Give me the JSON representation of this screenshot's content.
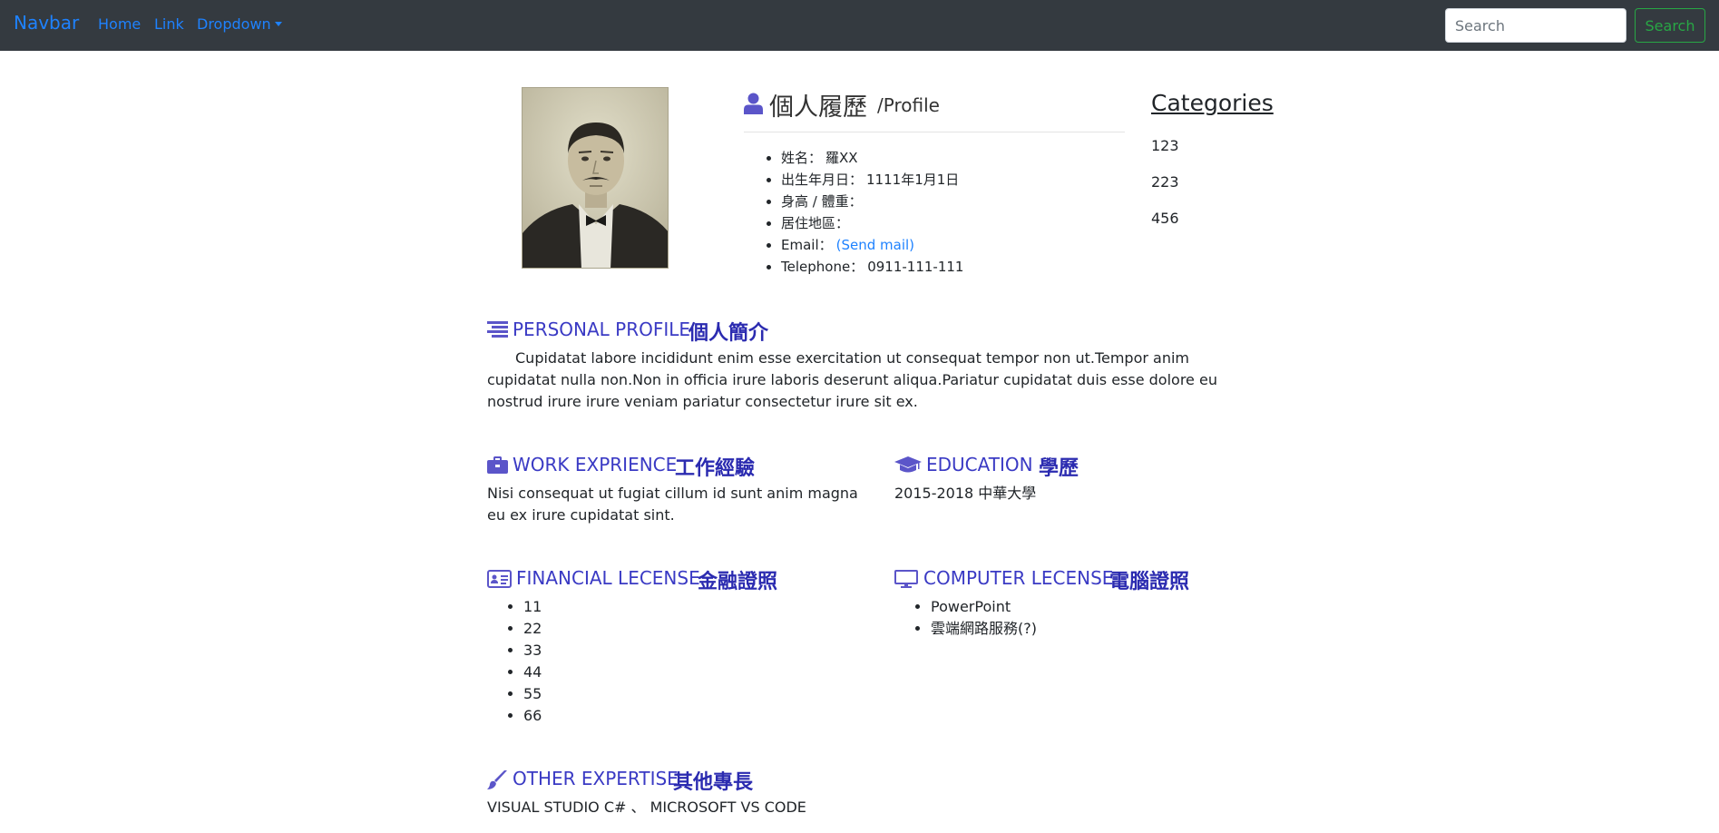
{
  "navbar": {
    "brand": "Navbar",
    "links": [
      "Home",
      "Link",
      "Dropdown"
    ],
    "search_placeholder": "Search",
    "search_button": "Search"
  },
  "photo": {
    "description_icon": "portrait-photo"
  },
  "profile": {
    "title": "個人履歷",
    "subtitle": "/Profile",
    "items": [
      {
        "label": "姓名：",
        "value": "羅XX"
      },
      {
        "label": "出生年月日：",
        "value": "1111年1月1日"
      },
      {
        "label": "身高 / 體重：",
        "value": ""
      },
      {
        "label": "居住地區：",
        "value": ""
      },
      {
        "label": "Email：",
        "value": "(Send mail)"
      },
      {
        "label": "Telephone：",
        "value": "0911-111-111"
      }
    ]
  },
  "categories": {
    "heading": "Categories",
    "items": [
      "123",
      "223",
      "456"
    ]
  },
  "sections": {
    "personal": {
      "title_en": "PERSONAL PROFILE",
      "title_zh": "個人簡介",
      "text": "Cupidatat labore incididunt enim esse exercitation ut consequat tempor non ut.Tempor anim cupidatat nulla non.Non in officia irure laboris deserunt aliqua.Pariatur cupidatat duis esse dolore eu nostrud irure irure veniam pariatur consectetur irure sit ex."
    },
    "work": {
      "title_en": "WORK EXPRIENCE",
      "title_zh": "工作經驗",
      "text": "Nisi consequat ut fugiat cillum id sunt anim magna eu ex irure cupidatat sint."
    },
    "education": {
      "title_en": "EDUCATION",
      "title_zh": "學歷",
      "text": "2015-2018 中華大學"
    },
    "financial": {
      "title_en": "FINANCIAL LECENSE",
      "title_zh": "金融證照",
      "items": [
        "11",
        "22",
        "33",
        "44",
        "55",
        "66"
      ]
    },
    "computer": {
      "title_en": "COMPUTER LECENSE",
      "title_zh": "電腦證照",
      "items": [
        "PowerPoint",
        "雲端網路服務(?)"
      ]
    },
    "other": {
      "title_en": "OTHER EXPERTISE",
      "title_zh": "其他專長",
      "text": "VISUAL STUDIO C# 、 MICROSOFT VS CODE"
    }
  },
  "colors": {
    "navbar_bg": "#343a40",
    "link": "#1e82ff",
    "section_title": "#3a3ac4",
    "icon": "#5b55c9",
    "search_button": "#28a745"
  }
}
